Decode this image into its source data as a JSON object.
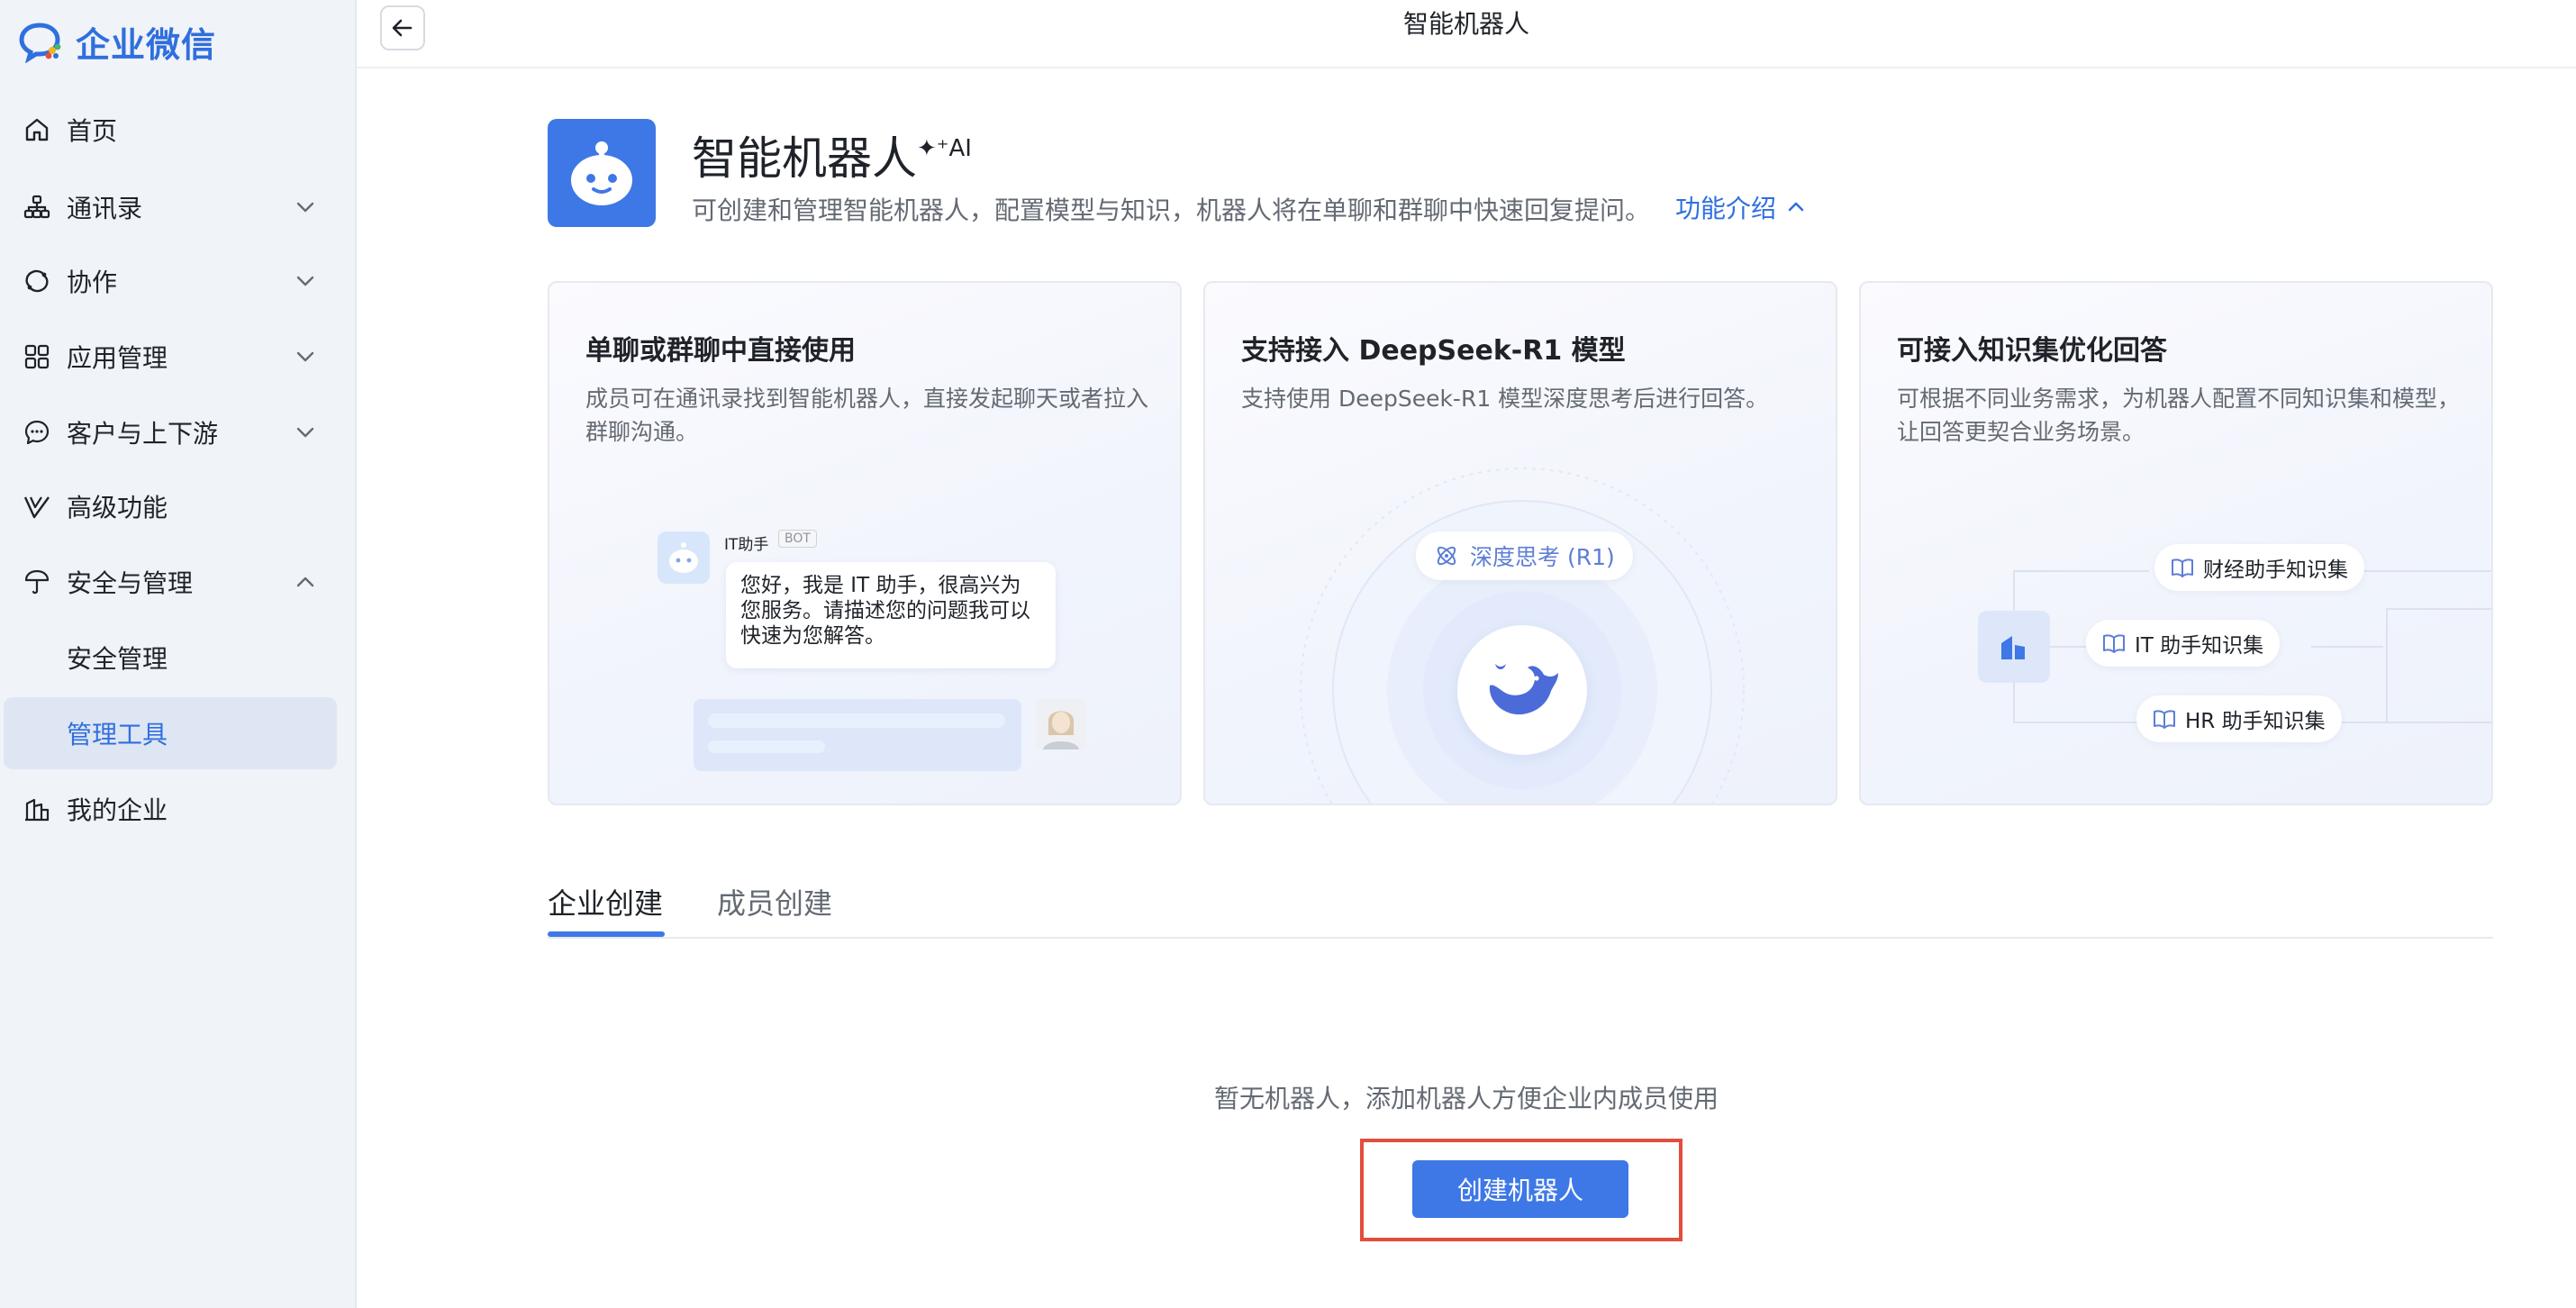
{
  "app": {
    "logo_text": "企业微信"
  },
  "sidebar": {
    "items": [
      {
        "label": "首页"
      },
      {
        "label": "通讯录"
      },
      {
        "label": "协作"
      },
      {
        "label": "应用管理"
      },
      {
        "label": "客户与上下游"
      },
      {
        "label": "高级功能"
      },
      {
        "label": "安全与管理"
      },
      {
        "label": "安全管理"
      },
      {
        "label": "管理工具"
      },
      {
        "label": "我的企业"
      }
    ],
    "active_item": "管理工具"
  },
  "topbar": {
    "title": "智能机器人"
  },
  "header": {
    "title": "智能机器人",
    "ai_badge": "✦⁺AI",
    "description": "可创建和管理智能机器人，配置模型与知识，机器人将在单聊和群聊中快速回复提问。",
    "intro_link": "功能介绍"
  },
  "cards": [
    {
      "title": "单聊或群聊中直接使用",
      "description": "成员可在通讯录找到智能机器人，直接发起聊天或者拉入群聊沟通。",
      "bot_name": "IT助手",
      "bot_tag": "BOT",
      "bubble_text": "您好，我是 IT 助手，很高兴为您服务。请描述您的问题我可以快速为您解答。"
    },
    {
      "title": "支持接入 DeepSeek-R1 模型",
      "description": "支持使用 DeepSeek-R1 模型深度思考后进行回答。",
      "pill_text": "深度思考 (R1)"
    },
    {
      "title": "可接入知识集优化回答",
      "description": "可根据不同业务需求，为机器人配置不同知识集和模型，让回答更契合业务场景。",
      "knowledge_sets": [
        "财经助手知识集",
        "IT 助手知识集",
        "HR 助手知识集"
      ]
    }
  ],
  "tabs": [
    {
      "label": "企业创建",
      "active": true
    },
    {
      "label": "成员创建",
      "active": false
    }
  ],
  "empty_state": {
    "text": "暂无机器人，添加机器人方便企业内成员使用",
    "button_label": "创建机器人"
  },
  "colors": {
    "accent": "#3e78e6",
    "sidebar_bg": "#f0f3f8",
    "highlight": "#e34d3c"
  },
  "icons": {
    "home": "home-icon",
    "contacts": "org-chart-icon",
    "collab": "collab-icon",
    "apps": "grid-icon",
    "customers": "chat-bubble-icon",
    "advanced": "check-mark-icon",
    "security": "shield-umbrella-icon",
    "enterprise": "building-icon"
  }
}
